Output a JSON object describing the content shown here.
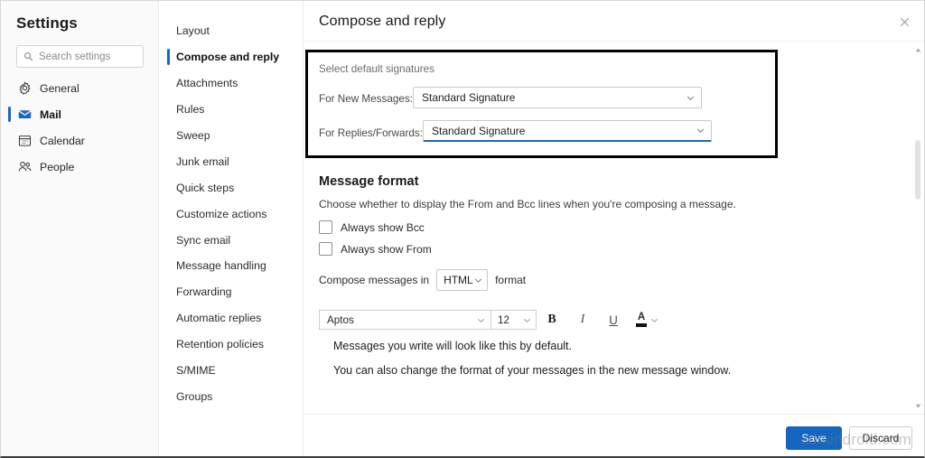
{
  "sidebar": {
    "title": "Settings",
    "search": {
      "placeholder": "Search settings",
      "value": "",
      "icon": "search-icon"
    },
    "items": [
      {
        "label": "General",
        "icon": "gear-icon",
        "active": false
      },
      {
        "label": "Mail",
        "icon": "envelope-icon",
        "active": true
      },
      {
        "label": "Calendar",
        "icon": "calendar-icon",
        "active": false
      },
      {
        "label": "People",
        "icon": "people-icon",
        "active": false
      }
    ]
  },
  "subnav": {
    "items": [
      {
        "label": "Layout",
        "active": false
      },
      {
        "label": "Compose and reply",
        "active": true
      },
      {
        "label": "Attachments",
        "active": false
      },
      {
        "label": "Rules",
        "active": false
      },
      {
        "label": "Sweep",
        "active": false
      },
      {
        "label": "Junk email",
        "active": false
      },
      {
        "label": "Quick steps",
        "active": false
      },
      {
        "label": "Customize actions",
        "active": false
      },
      {
        "label": "Sync email",
        "active": false
      },
      {
        "label": "Message handling",
        "active": false
      },
      {
        "label": "Forwarding",
        "active": false
      },
      {
        "label": "Automatic replies",
        "active": false
      },
      {
        "label": "Retention policies",
        "active": false
      },
      {
        "label": "S/MIME",
        "active": false
      },
      {
        "label": "Groups",
        "active": false
      }
    ]
  },
  "header": {
    "title": "Compose and reply",
    "close_icon": "close-icon"
  },
  "signatures": {
    "section_label": "Select default signatures",
    "new_messages_label": "For New Messages:",
    "new_messages_value": "Standard Signature",
    "replies_label": "For Replies/Forwards:",
    "replies_value": "Standard Signature",
    "focus_color": "#1668c1"
  },
  "message_format": {
    "title": "Message format",
    "description": "Choose whether to display the From and Bcc lines when you're composing a message.",
    "checkboxes": [
      {
        "label": "Always show Bcc",
        "checked": false
      },
      {
        "label": "Always show From",
        "checked": false
      }
    ],
    "compose_prefix": "Compose messages in",
    "compose_value": "HTML",
    "compose_suffix": "format"
  },
  "toolbar": {
    "font_name": "Aptos",
    "font_size": "12",
    "bold_label": "B",
    "italic_label": "I",
    "underline_label": "U",
    "font_color_label": "A",
    "font_color": "#111111"
  },
  "preview": {
    "line1": "Messages you write will look like this by default.",
    "line2": "You can also change the format of your messages in the new message window."
  },
  "footer": {
    "save_label": "Save",
    "discard_label": "Discard",
    "save_color": "#1566c0"
  },
  "watermark": {
    "text": "admindroid.com"
  }
}
